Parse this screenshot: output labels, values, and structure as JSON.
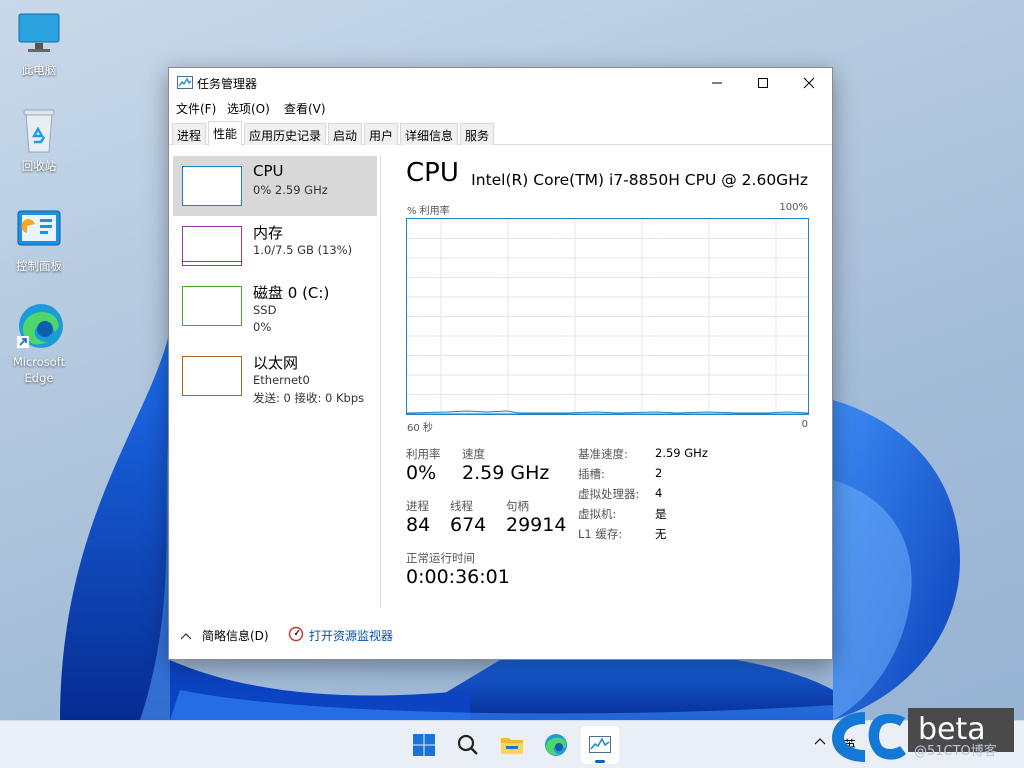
{
  "desktop": {
    "icons": [
      {
        "label": "此电脑",
        "icon": "monitor-icon"
      },
      {
        "label": "回收站",
        "icon": "recycle-bin-icon"
      },
      {
        "label": "控制面板",
        "icon": "control-panel-icon"
      },
      {
        "label": "Microsoft Edge",
        "icon": "edge-icon"
      }
    ]
  },
  "window": {
    "title": "任务管理器",
    "menu": [
      "文件(F)",
      "选项(O)",
      "查看(V)"
    ],
    "tabs": [
      "进程",
      "性能",
      "应用历史记录",
      "启动",
      "用户",
      "详细信息",
      "服务"
    ],
    "active_tab": "性能",
    "sidebar": [
      {
        "name": "CPU",
        "line1": "0% 2.59 GHz",
        "line2": "",
        "border_color": "#1d86c9",
        "selected": true
      },
      {
        "name": "内存",
        "line1": "1.0/7.5 GB (13%)",
        "line2": "",
        "border_color": "#8e3b9e",
        "selected": false
      },
      {
        "name": "磁盘 0 (C:)",
        "line1": "SSD",
        "line2": "0%",
        "border_color": "#4ca428",
        "selected": false
      },
      {
        "name": "以太网",
        "line1": "Ethernet0",
        "line2": "发送: 0 接收: 0 Kbps",
        "border_color": "#a7671c",
        "selected": false
      }
    ],
    "detail": {
      "title": "CPU",
      "model": "Intel(R) Core(TM) i7-8850H CPU @ 2.60GHz",
      "graph": {
        "ylabel": "% 利用率",
        "ymax_label": "100%",
        "xleft_label": "60 秒",
        "xright_label": "0",
        "color": "#1d86c9"
      },
      "stats": {
        "util_label": "利用率",
        "util_value": "0%",
        "speed_label": "速度",
        "speed_value": "2.59 GHz",
        "proc_label": "进程",
        "proc_value": "84",
        "thread_label": "线程",
        "thread_value": "674",
        "handle_label": "句柄",
        "handle_value": "29914",
        "uptime_label": "正常运行时间",
        "uptime_value": "0:00:36:01"
      },
      "specs": [
        {
          "key": "基准速度:",
          "value": "2.59 GHz"
        },
        {
          "key": "插槽:",
          "value": "2"
        },
        {
          "key": "虚拟处理器:",
          "value": "4"
        },
        {
          "key": "虚拟机:",
          "value": "是"
        },
        {
          "key": "L1 缓存:",
          "value": "无"
        }
      ]
    },
    "footer": {
      "brief_label": "简略信息(D)",
      "resource_monitor_label": "打开资源监视器"
    }
  },
  "taskbar": {
    "apps": [
      "start-icon",
      "search-icon",
      "file-explorer-icon",
      "edge-icon",
      "task-manager-icon"
    ],
    "ime": "英"
  },
  "watermark": {
    "brand": "beta",
    "blog": "@51CTO博客"
  }
}
